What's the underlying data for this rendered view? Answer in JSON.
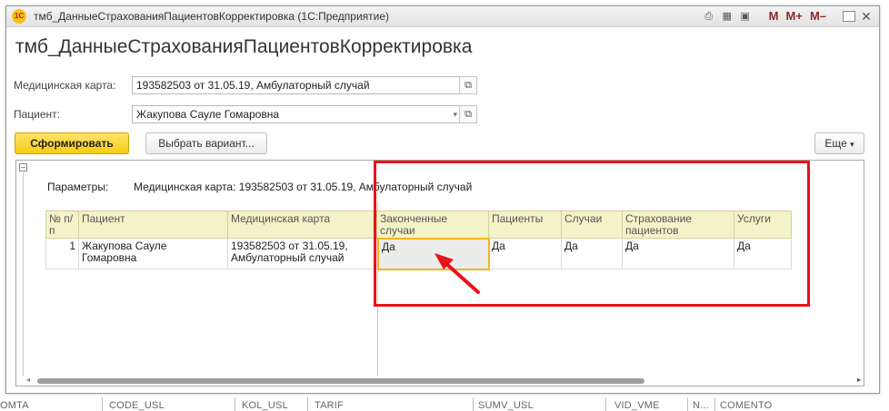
{
  "window": {
    "title": "тмб_ДанныеСтрахованияПациентовКорректировка (1С:Предприятие)",
    "app_icon_text": "1С",
    "toolbar_icons": [
      "print-icon",
      "calculator-icon",
      "calendar-icon"
    ],
    "memory_buttons": [
      "M",
      "M+",
      "M–"
    ]
  },
  "page": {
    "title": "тмб_ДанныеСтрахованияПациентовКорректировка"
  },
  "form": {
    "med_card": {
      "label": "Медицинская карта:",
      "value": "193582503 от 31.05.19, Амбулаторный случай"
    },
    "patient": {
      "label": "Пациент:",
      "value": "Жакупова Сауле Гомаровна"
    }
  },
  "actions": {
    "generate": "Сформировать",
    "choose_variant": "Выбрать вариант...",
    "more": "Еще"
  },
  "report": {
    "params_label": "Параметры:",
    "params_value": "Медицинская карта: 193582503 от 31.05.19, Амбулаторный случай",
    "columns": [
      "№ п/п",
      "Пациент",
      "Медицинская карта",
      "Законченные случаи",
      "Пациенты",
      "Случаи",
      "Страхование пациентов",
      "Услуги"
    ],
    "rows": [
      {
        "num": "1",
        "patient": "Жакупова Сауле Гомаровна",
        "med_card": "193582503 от 31.05.19, Амбулаторный случай",
        "finished_cases": "Да",
        "patients": "Да",
        "cases": "Да",
        "insurance": "Да",
        "services": "Да"
      }
    ]
  },
  "bottom_strip": [
    "OMTA",
    "CODE_USL",
    "KOL_USL",
    "TARIF",
    "SUMV_USL",
    "VID_VME",
    "N...",
    "COMENTO"
  ],
  "colors": {
    "accent_button": "#f7cd12",
    "header_cell": "#f4f2c7",
    "highlight": "#e8131a",
    "selection": "#f3b51b"
  }
}
